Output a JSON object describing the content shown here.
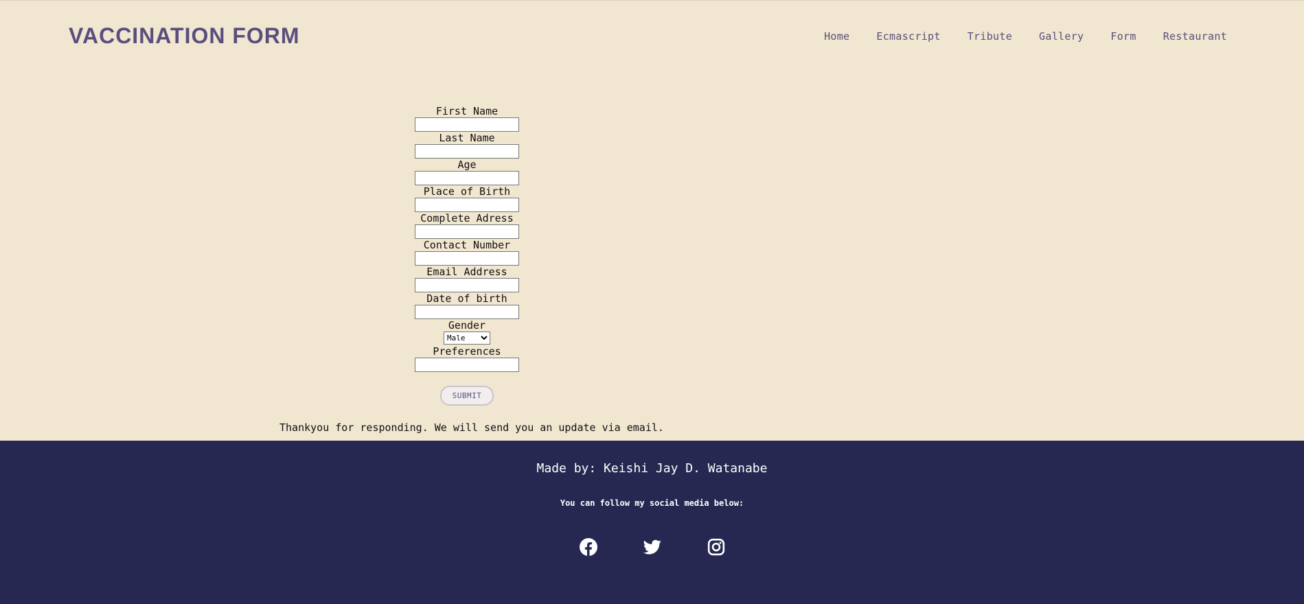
{
  "header": {
    "brand": "VACCINATION FORM",
    "nav": [
      "Home",
      "Ecmascript",
      "Tribute",
      "Gallery",
      "Form",
      "Restaurant"
    ]
  },
  "form": {
    "fields": [
      {
        "label": "First Name",
        "value": ""
      },
      {
        "label": "Last Name",
        "value": ""
      },
      {
        "label": "Age",
        "value": ""
      },
      {
        "label": "Place of Birth",
        "value": ""
      },
      {
        "label": "Complete Adress",
        "value": ""
      },
      {
        "label": "Contact Number",
        "value": ""
      },
      {
        "label": "Email Address",
        "value": ""
      },
      {
        "label": "Date of birth",
        "value": ""
      }
    ],
    "gender": {
      "label": "Gender",
      "selected": "Male"
    },
    "preferences": {
      "label": "Preferences",
      "value": ""
    },
    "submit_label": "SUBMIT"
  },
  "thanks_message": "Thankyou for responding. We will send you an update via email.",
  "footer": {
    "made_by": "Made by: Keishi Jay D. Watanabe",
    "follow_text": "You can follow my social media below:",
    "socials": [
      "facebook-icon",
      "twitter-icon",
      "instagram-icon"
    ]
  },
  "colors": {
    "background": "#f1e6d0",
    "accent": "#5a4e7e",
    "footer": "#262851"
  }
}
